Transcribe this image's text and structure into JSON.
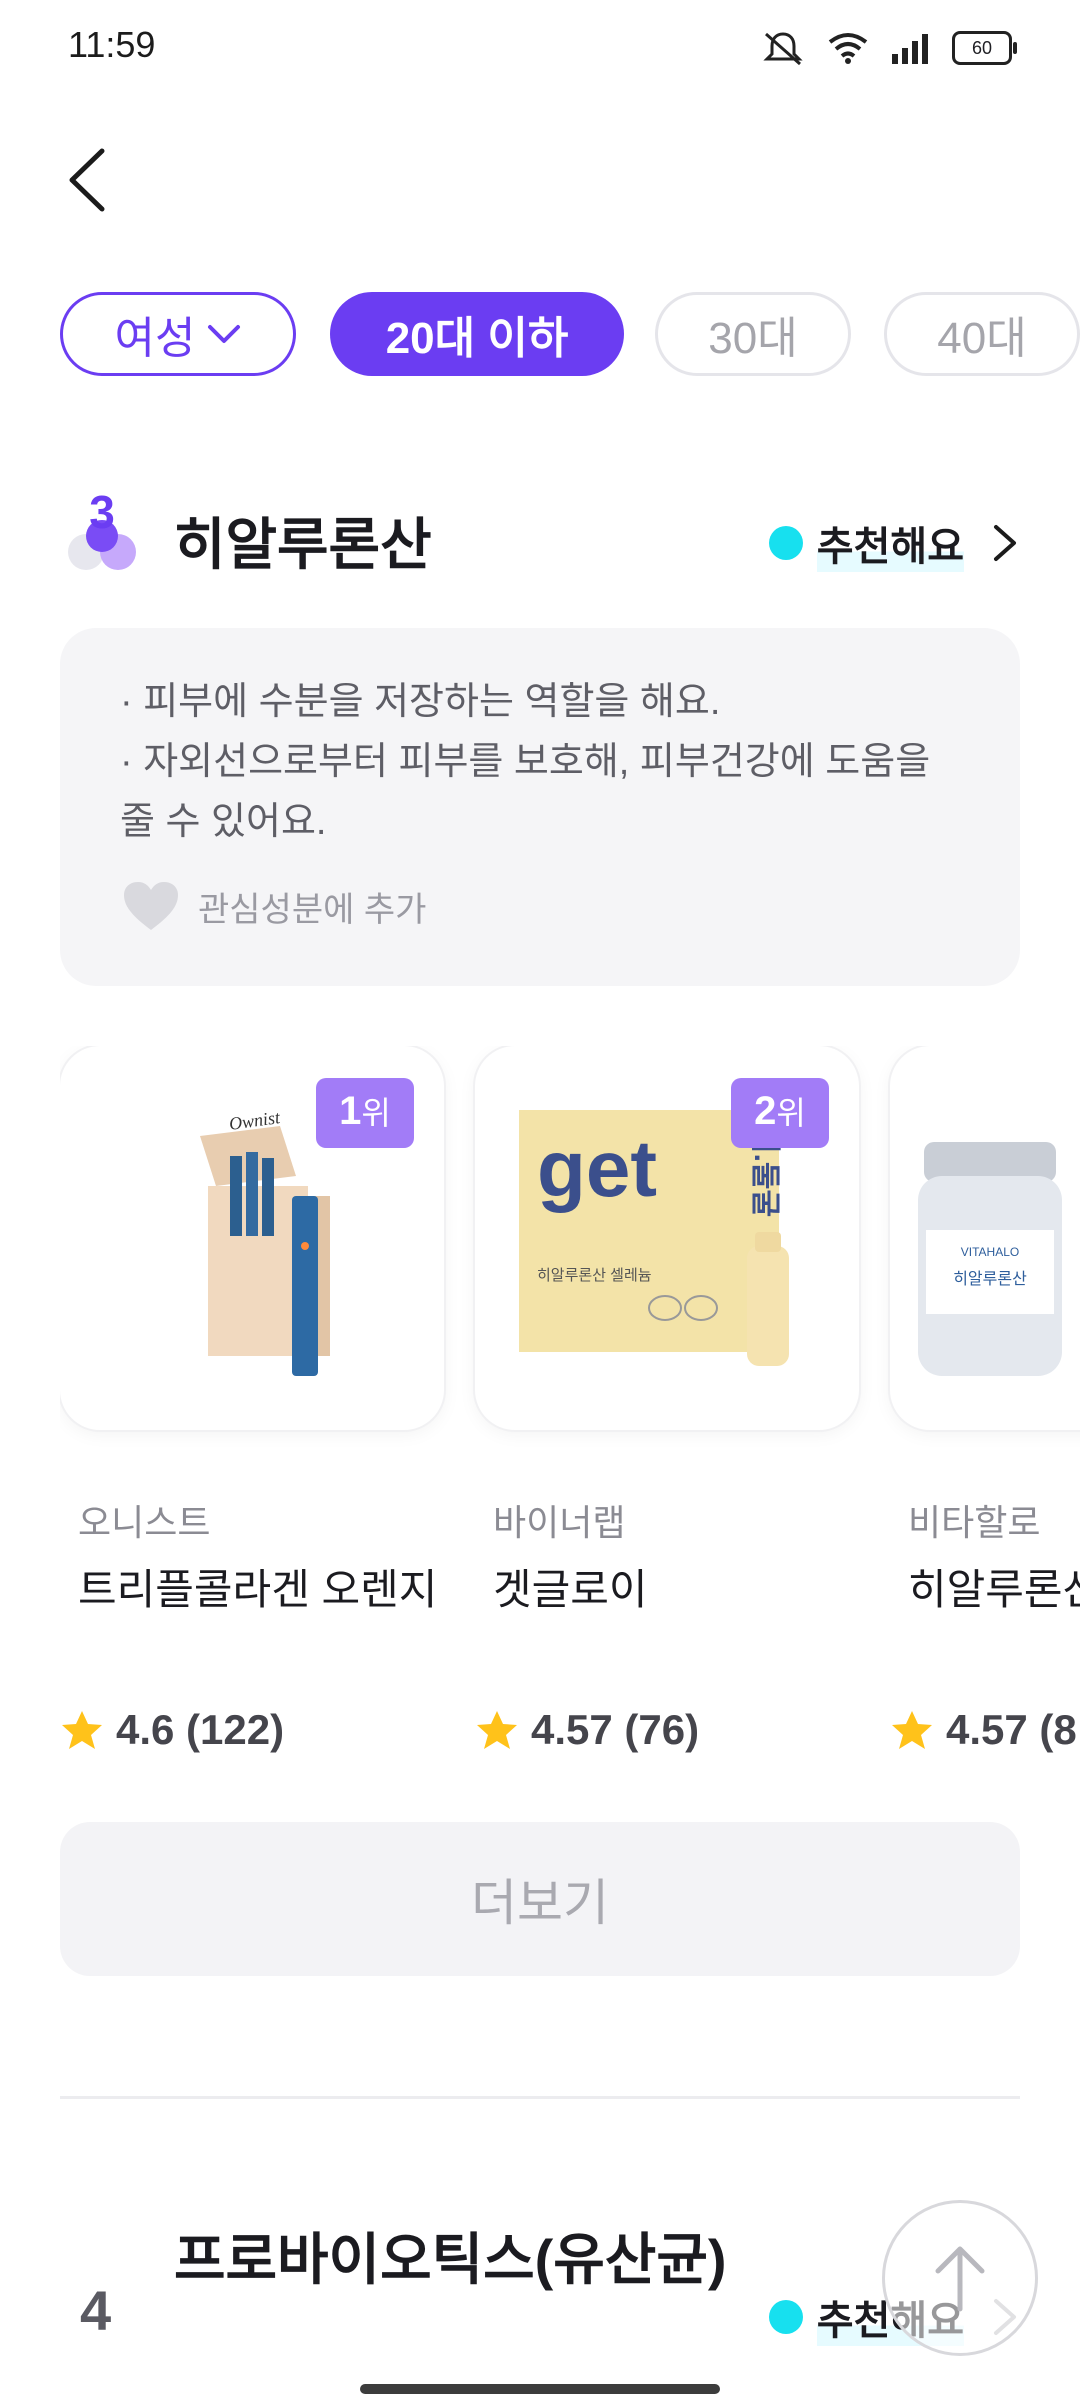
{
  "status": {
    "time": "11:59",
    "battery": "60"
  },
  "filters": {
    "gender": "여성",
    "age_selected": "20대 이하",
    "age_30": "30대",
    "age_40": "40대"
  },
  "section": {
    "rank": "3",
    "title": "히알루론산",
    "recommend": "추천해요",
    "desc1": "· 피부에 수분을 저장하는 역할을 해요.",
    "desc2": "· 자외선으로부터 피부를 보호해, 피부건강에 도움을",
    "desc3": "줄 수 있어요.",
    "favorite": "관심성분에 추가"
  },
  "products": [
    {
      "rank": "1",
      "rank_unit": "위",
      "brand": "오니스트",
      "name": "트리플콜라겐 오렌지",
      "rating": "4.6 (122)",
      "image_text": "Ownist"
    },
    {
      "rank": "2",
      "rank_unit": "위",
      "brand": "바이너랩",
      "name": "겟글로이",
      "rating": "4.57 (76)",
      "image_text": "get",
      "image_text2": "히알루론산 셀레늄",
      "image_text3": "이.둘굴"
    },
    {
      "brand": "비타할로",
      "name": "히알루론산",
      "rating": "4.57 (8",
      "image_text": "VITAHALO",
      "image_text2": "히알루론산"
    }
  ],
  "more": "더보기",
  "section2": {
    "rank": "4",
    "title": "프로바이오틱스(유산균)",
    "recommend": "추천해요"
  },
  "colors": {
    "accent": "#6b3df2",
    "rank_tag": "#a27cf7",
    "recommend_dot": "#17e0ef",
    "star": "#ffc21a"
  }
}
